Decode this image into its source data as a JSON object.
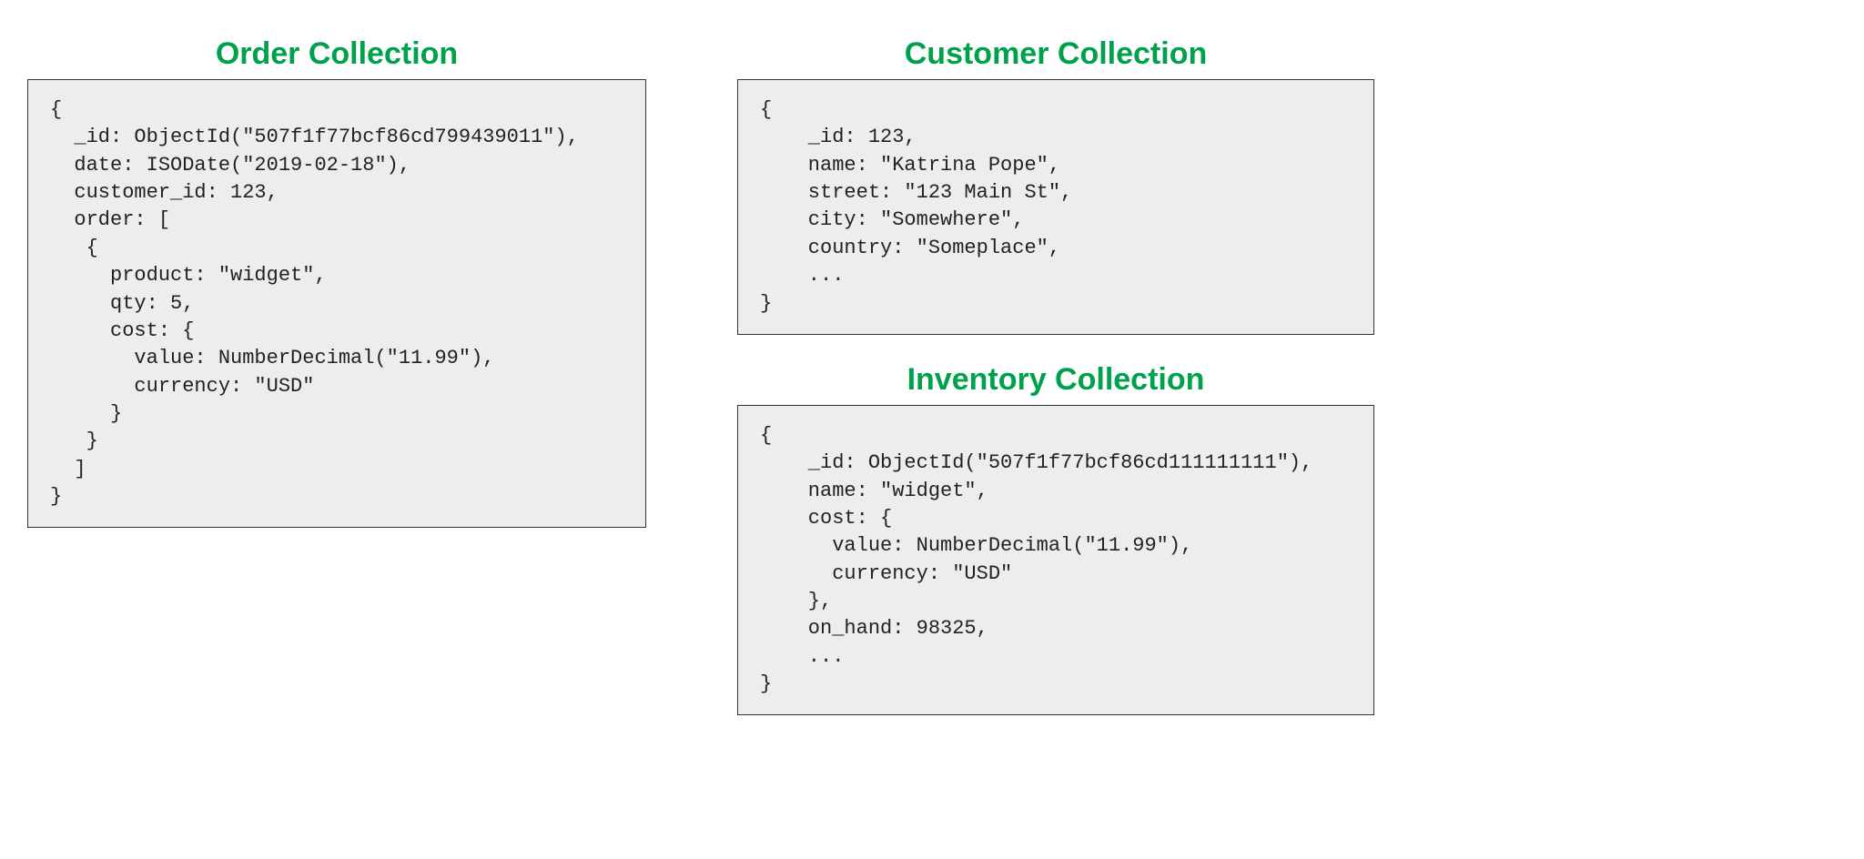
{
  "order": {
    "title": "Order Collection",
    "body": "{\n  _id: ObjectId(\"507f1f77bcf86cd799439011\"),\n  date: ISODate(\"2019-02-18\"),\n  customer_id: 123,\n  order: [\n   {\n     product: \"widget\",\n     qty: 5,\n     cost: {\n       value: NumberDecimal(\"11.99\"),\n       currency: \"USD\"\n     }\n   }\n  ]\n}"
  },
  "customer": {
    "title": "Customer Collection",
    "body": "{\n    _id: 123,\n    name: \"Katrina Pope\",\n    street: \"123 Main St\",\n    city: \"Somewhere\",\n    country: \"Someplace\",\n    ...\n}"
  },
  "inventory": {
    "title": "Inventory Collection",
    "body": "{\n    _id: ObjectId(\"507f1f77bcf86cd111111111\"),\n    name: \"widget\",\n    cost: {\n      value: NumberDecimal(\"11.99\"),\n      currency: \"USD\"\n    },\n    on_hand: 98325,\n    ...\n}"
  }
}
